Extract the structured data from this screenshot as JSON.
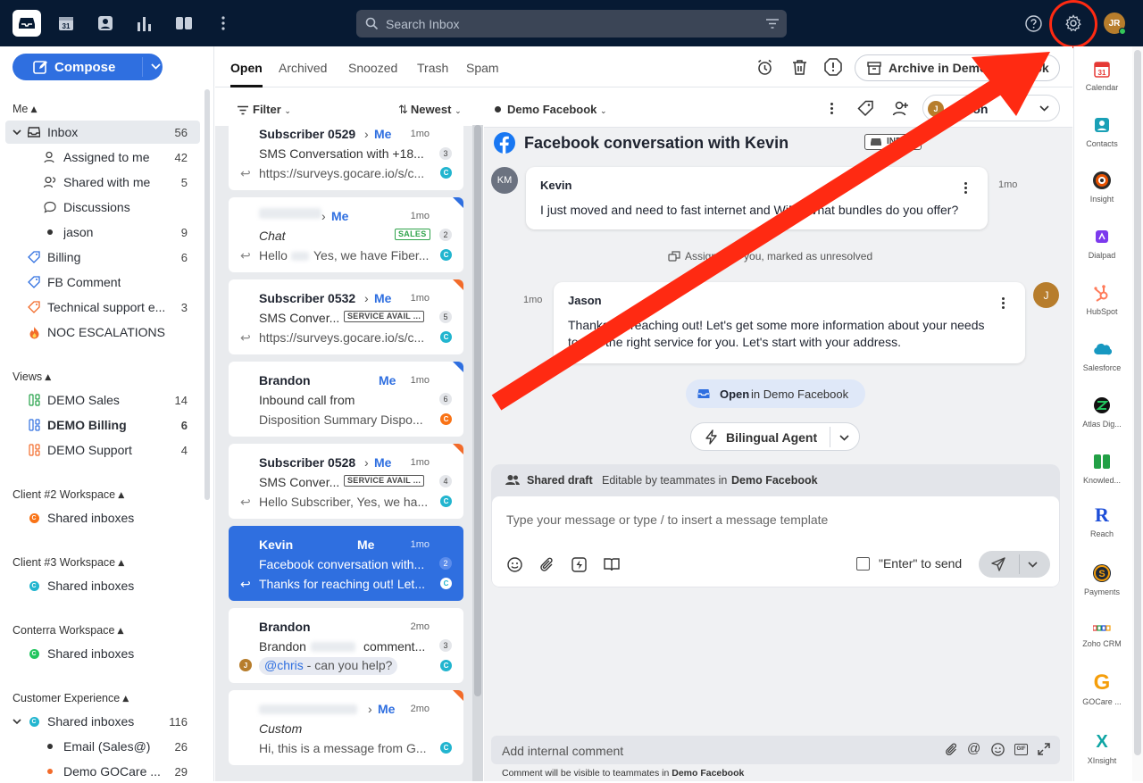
{
  "topbar": {
    "search_placeholder": "Search Inbox",
    "avatar_initials": "JR",
    "calendar_day": "31"
  },
  "sidebar": {
    "compose_label": "Compose",
    "me_section": "Me",
    "me_items": [
      {
        "label": "Inbox",
        "count": "56"
      },
      {
        "label": "Assigned to me",
        "count": "42"
      },
      {
        "label": "Shared with me",
        "count": "5"
      },
      {
        "label": "Discussions",
        "count": ""
      },
      {
        "label": "jason",
        "count": "9"
      },
      {
        "label": "Billing",
        "count": "6"
      },
      {
        "label": "FB Comment",
        "count": ""
      },
      {
        "label": "Technical support e...",
        "count": "3"
      },
      {
        "label": "NOC ESCALATIONS",
        "count": ""
      }
    ],
    "views_section": "Views",
    "views": [
      {
        "label": "DEMO Sales",
        "count": "14"
      },
      {
        "label": "DEMO Billing",
        "count": "6"
      },
      {
        "label": "DEMO Support",
        "count": "4"
      }
    ],
    "workspaces": [
      {
        "title": "Client #2 Workspace",
        "item": "Shared inboxes",
        "count": ""
      },
      {
        "title": "Client #3 Workspace",
        "item": "Shared inboxes",
        "count": ""
      },
      {
        "title": "Conterra Workspace",
        "item": "Shared inboxes",
        "count": ""
      },
      {
        "title": "Customer Experience",
        "item": "Shared inboxes",
        "count": "116"
      }
    ],
    "cx_sub": [
      {
        "label": "Email (Sales@)",
        "count": "26"
      },
      {
        "label": "Demo GOCare ...",
        "count": "29"
      }
    ]
  },
  "tabs": {
    "items": [
      "Open",
      "Archived",
      "Snoozed",
      "Trash",
      "Spam"
    ],
    "archive_label": "Archive in Demo Facebook"
  },
  "list": {
    "filter_label": "Filter",
    "sort_label": "Newest",
    "cards": [
      {
        "name": "Subscriber 0529",
        "me": "Me",
        "time": "1mo",
        "line2": "SMS Conversation with +18...",
        "line3": "https://surveys.gocare.io/s/c...",
        "count": "3",
        "c": "C"
      },
      {
        "name": "",
        "me": "Me",
        "time": "1mo",
        "line2": "Chat",
        "badge": "SALES",
        "line3a": "Hello",
        "line3b": "Yes, we have Fiber...",
        "count": "2",
        "c": "C"
      },
      {
        "name": "Subscriber 0532",
        "me": "Me",
        "time": "1mo",
        "line2": "SMS Conver...",
        "badge": "SERVICE AVAIL ...",
        "line3": "https://surveys.gocare.io/s/c...",
        "count": "5",
        "c": "C"
      },
      {
        "name": "Brandon",
        "me": "Me",
        "time": "1mo",
        "line2": "Inbound call from",
        "line3": "Disposition Summary Dispo...",
        "count": "6",
        "c": "C"
      },
      {
        "name": "Subscriber 0528",
        "me": "Me",
        "time": "1mo",
        "line2": "SMS Conver...",
        "badge": "SERVICE AVAIL ...",
        "line3": "Hello Subscriber, Yes, we ha...",
        "count": "4",
        "c": "C"
      },
      {
        "name": "Kevin",
        "me": "Me",
        "time": "1mo",
        "line2": "Facebook conversation with...",
        "line3": "Thanks for reaching out! Let...",
        "count": "2",
        "c": "C"
      },
      {
        "name": "Brandon",
        "me": "",
        "time": "2mo",
        "line2a": "Brandon",
        "line2b": "comment...",
        "mention": "@chris",
        "mention_rest": " - can you help?",
        "count": "3",
        "c": "C",
        "avatar": "J"
      },
      {
        "name": "",
        "me": "Me",
        "time": "2mo",
        "line2": "Custom",
        "line3": "Hi, this is a message from G...",
        "count": "",
        "c": "C"
      }
    ]
  },
  "conversation": {
    "channel": "Demo Facebook",
    "title": "Facebook conversation with Kevin",
    "tag": "INBOX",
    "assignee": "Jason",
    "msg1": {
      "initials": "KM",
      "author": "Kevin",
      "time": "1mo",
      "text": "I just moved and need to fast internet and WiFi. What bundles do you offer?"
    },
    "event": "Assigned to you, marked as unresolved",
    "msg2": {
      "initials": "J",
      "author": "Jason",
      "time": "1mo",
      "text1": "Thanks for reaching out! Let's get some more information about your needs",
      "text2": "to find the right service for you. Let's start with your address."
    },
    "status_open": "Open",
    "status_in": "in Demo Facebook",
    "agent_button": "Bilingual Agent",
    "draft_label": "Shared draft",
    "draft_editable": "Editable by teammates in",
    "draft_inbox": "Demo Facebook",
    "draft_placeholder": "Type your message or type / to insert a message template",
    "enter_to_send": "\"Enter\" to send",
    "internal_placeholder": "Add internal comment",
    "internal_note": "Comment will be visible to teammates in",
    "internal_note_inbox": "Demo Facebook"
  },
  "apps": [
    {
      "label": "Calendar",
      "icon": "31",
      "color": "#e53935"
    },
    {
      "label": "Contacts",
      "icon": "contacts",
      "color": "#1aa0b6"
    },
    {
      "label": "Insight",
      "icon": "insight",
      "color": "#e65100"
    },
    {
      "label": "Dialpad",
      "icon": "dialpad",
      "color": "#7c3aed"
    },
    {
      "label": "HubSpot",
      "icon": "hubspot",
      "color": "#ff7a59"
    },
    {
      "label": "Salesforce",
      "icon": "salesforce",
      "color": "#1798c1"
    },
    {
      "label": "Atlas Dig...",
      "icon": "atlas",
      "color": "#111111"
    },
    {
      "label": "Knowled...",
      "icon": "knowledge",
      "color": "#22a046"
    },
    {
      "label": "Reach",
      "icon": "R",
      "color": "#1d4ed8"
    },
    {
      "label": "Payments",
      "icon": "S",
      "color": "#f59e0b"
    },
    {
      "label": "Zoho CRM",
      "icon": "zoho",
      "color": "#e53935"
    },
    {
      "label": "GOCare ...",
      "icon": "G",
      "color": "#f59e0b"
    },
    {
      "label": "XInsight",
      "icon": "X",
      "color": "#0ea5a4"
    }
  ],
  "colors": {
    "brand": "#2f6fe0",
    "topbar": "#071a33",
    "annotation": "#ff2a12"
  }
}
